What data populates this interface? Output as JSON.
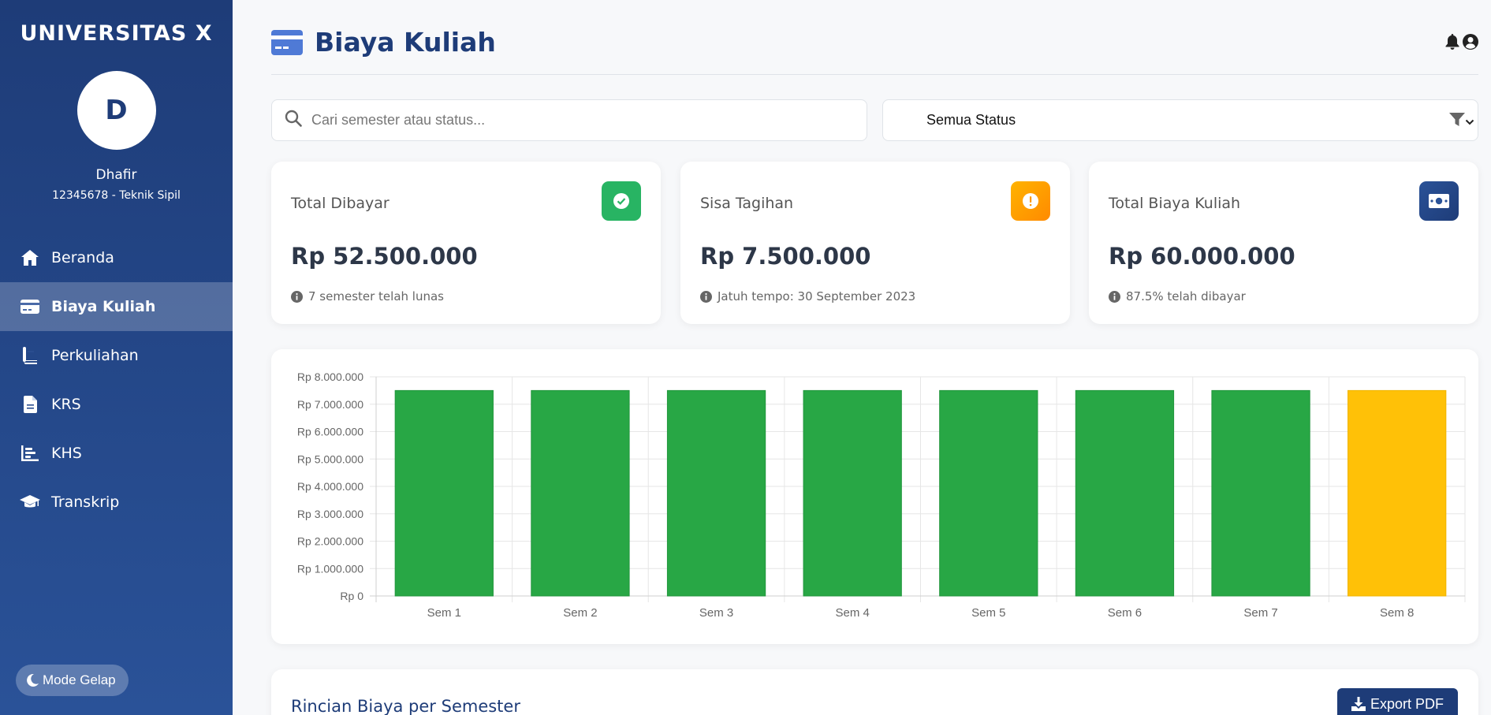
{
  "sidebar": {
    "brand": "UNIVERSITAS X",
    "avatar_initial": "D",
    "user_name": "Dhafir",
    "user_id": "12345678 - Teknik Sipil",
    "items": [
      {
        "label": "Beranda",
        "icon": "home-icon"
      },
      {
        "label": "Biaya Kuliah",
        "icon": "credit-card-icon",
        "active": true
      },
      {
        "label": "Perkuliahan",
        "icon": "book-icon"
      },
      {
        "label": "KRS",
        "icon": "file-icon"
      },
      {
        "label": "KHS",
        "icon": "bar-chart-icon"
      },
      {
        "label": "Transkrip",
        "icon": "graduation-cap-icon"
      }
    ],
    "dark_mode_label": "Mode Gelap"
  },
  "header": {
    "title": "Biaya Kuliah"
  },
  "filters": {
    "search_placeholder": "Cari semester atau status...",
    "status_value": "Semua Status"
  },
  "cards": [
    {
      "label": "Total Dibayar",
      "value": "Rp 52.500.000",
      "note": "7 semester telah lunas",
      "icon": "check-circle-icon",
      "color": "#28a745"
    },
    {
      "label": "Sisa Tagihan",
      "value": "Rp 7.500.000",
      "note": "Jatuh tempo: 30 September 2023",
      "icon": "exclamation-circle-icon",
      "color": "#ff9800"
    },
    {
      "label": "Total Biaya Kuliah",
      "value": "Rp 60.000.000",
      "note": "87.5% telah dibayar",
      "icon": "money-bill-icon",
      "color": "#2a5298"
    }
  ],
  "chart_data": {
    "type": "bar",
    "categories": [
      "Sem 1",
      "Sem 2",
      "Sem 3",
      "Sem 4",
      "Sem 5",
      "Sem 6",
      "Sem 7",
      "Sem 8"
    ],
    "values": [
      7500000,
      7500000,
      7500000,
      7500000,
      7500000,
      7500000,
      7500000,
      7500000
    ],
    "bar_colors": [
      "#28a745",
      "#28a745",
      "#28a745",
      "#28a745",
      "#28a745",
      "#28a745",
      "#28a745",
      "#ffc107"
    ],
    "ylim": [
      0,
      8000000
    ],
    "yticks": [
      0,
      1000000,
      2000000,
      3000000,
      4000000,
      5000000,
      6000000,
      7000000,
      8000000
    ],
    "ytick_labels": [
      "Rp 0",
      "Rp 1.000.000",
      "Rp 2.000.000",
      "Rp 3.000.000",
      "Rp 4.000.000",
      "Rp 5.000.000",
      "Rp 6.000.000",
      "Rp 7.000.000",
      "Rp 8.000.000"
    ],
    "grid": true
  },
  "detail": {
    "title": "Rincian Biaya per Semester",
    "export_label": "Export PDF"
  }
}
